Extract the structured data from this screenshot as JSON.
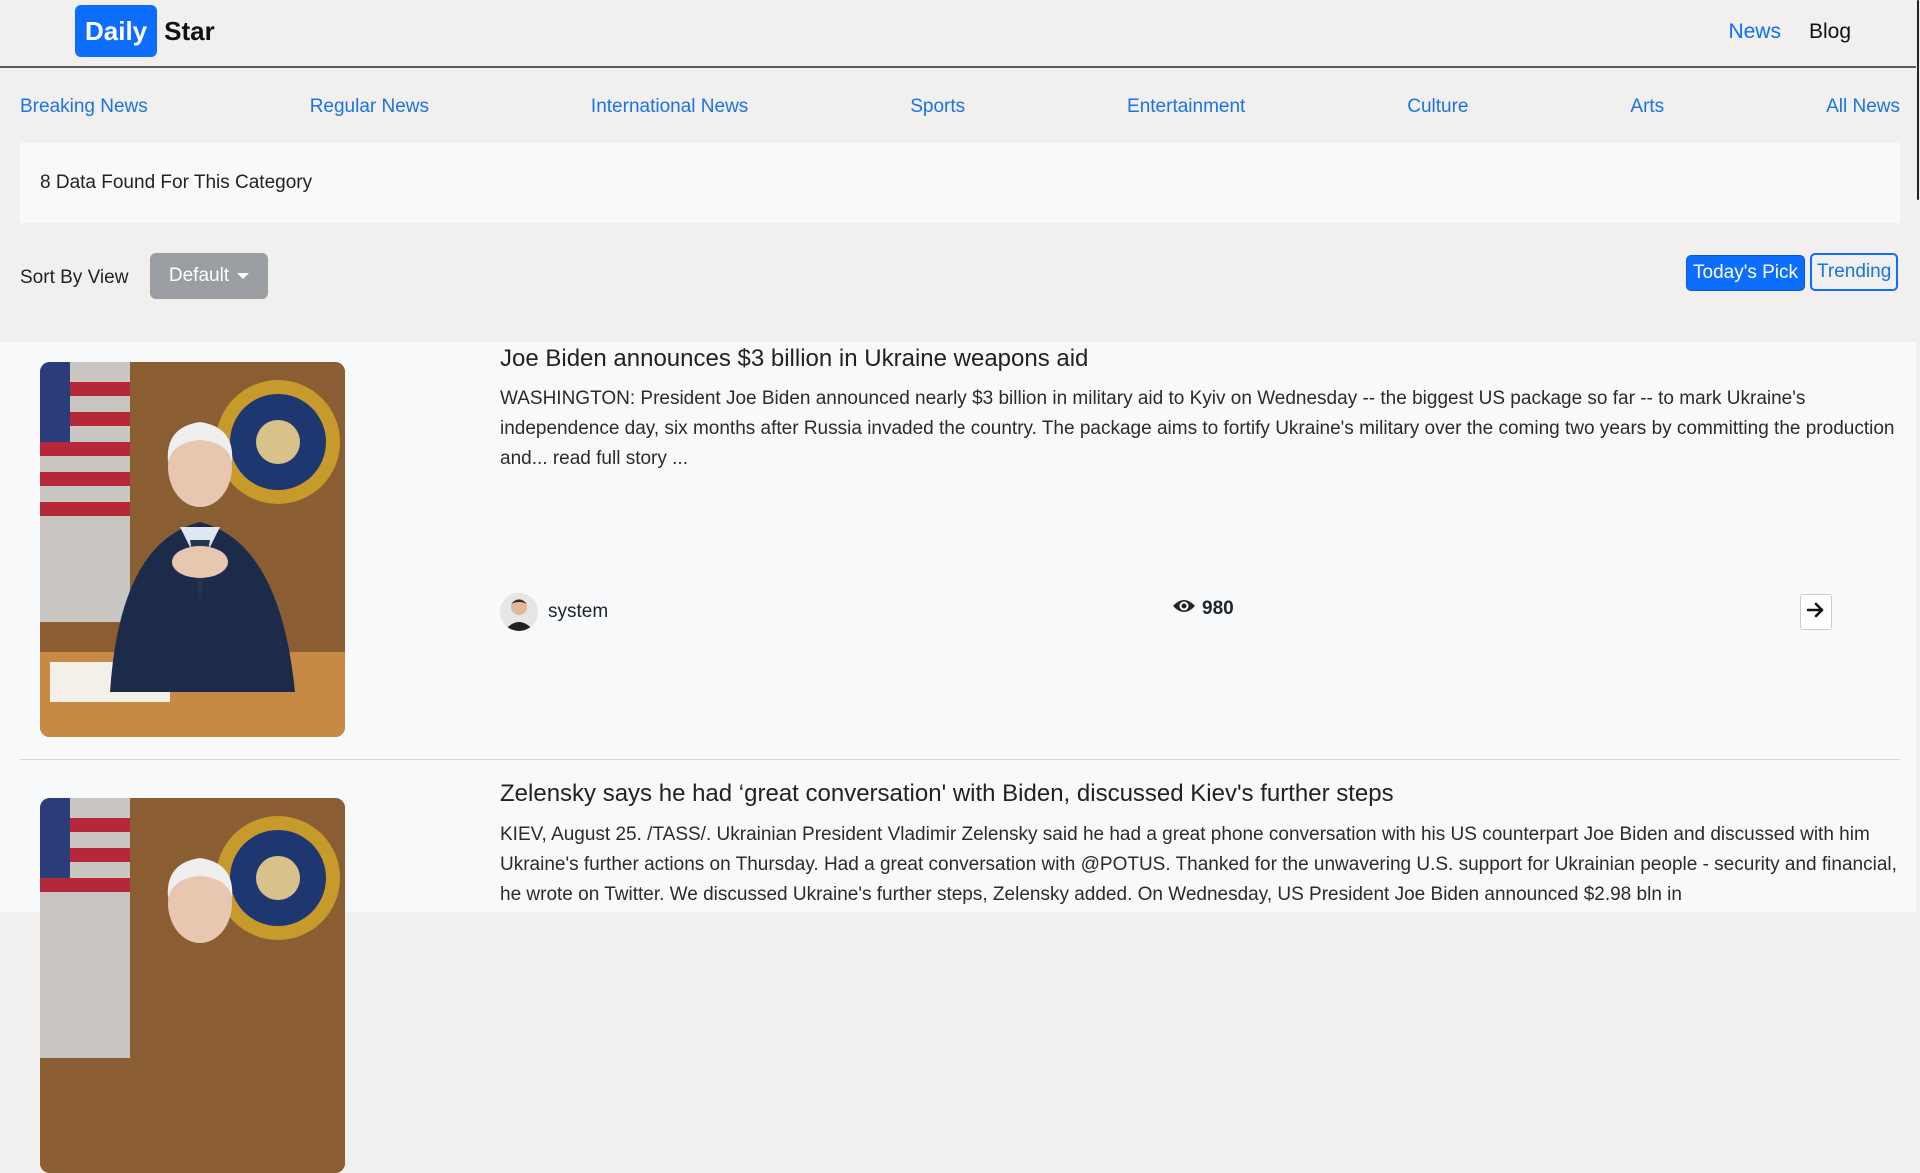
{
  "brand": {
    "daily": "Daily",
    "star": "Star"
  },
  "topnav": [
    {
      "label": "News",
      "active": true
    },
    {
      "label": "Blog",
      "active": false
    }
  ],
  "categories": [
    "Breaking News",
    "Regular News",
    "International News",
    "Sports",
    "Entertainment",
    "Culture",
    "Arts",
    "All News"
  ],
  "results": {
    "text": "8 Data Found For This Category"
  },
  "sort": {
    "label": "Sort By View",
    "selected": "Default"
  },
  "filters": {
    "today": "Today's Pick",
    "trending": "Trending"
  },
  "colors": {
    "primary": "#0d6efd",
    "link": "#1a73e8",
    "page_bg": "#f2efef",
    "card_bg": "#f8f9fa"
  },
  "news": [
    {
      "title": "Joe Biden announces $3 billion in Ukraine weapons aid",
      "summary": "WASHINGTON: President Joe Biden announced nearly $3 billion in military aid to Kyiv on Wednesday -- the biggest US package so far -- to mark Ukraine's independence day, six months after Russia invaded the country. The package aims to fortify Ukraine's military over the coming two years by committing the production and... read full story ...",
      "author": "system",
      "views": "980"
    },
    {
      "title": "Zelensky says he had ‘great conversation' with Biden, discussed Kiev's further steps",
      "summary": "KIEV, August 25. /TASS/. Ukrainian President Vladimir Zelensky said he had a great phone conversation with his US counterpart Joe Biden and discussed with him Ukraine's further actions on Thursday. Had a great conversation with @POTUS. Thanked for the unwavering U.S. support for Ukrainian people - security and financial, he wrote on Twitter. We discussed Ukraine's further steps, Zelensky added. On Wednesday, US President Joe Biden announced $2.98 bln in"
    }
  ]
}
